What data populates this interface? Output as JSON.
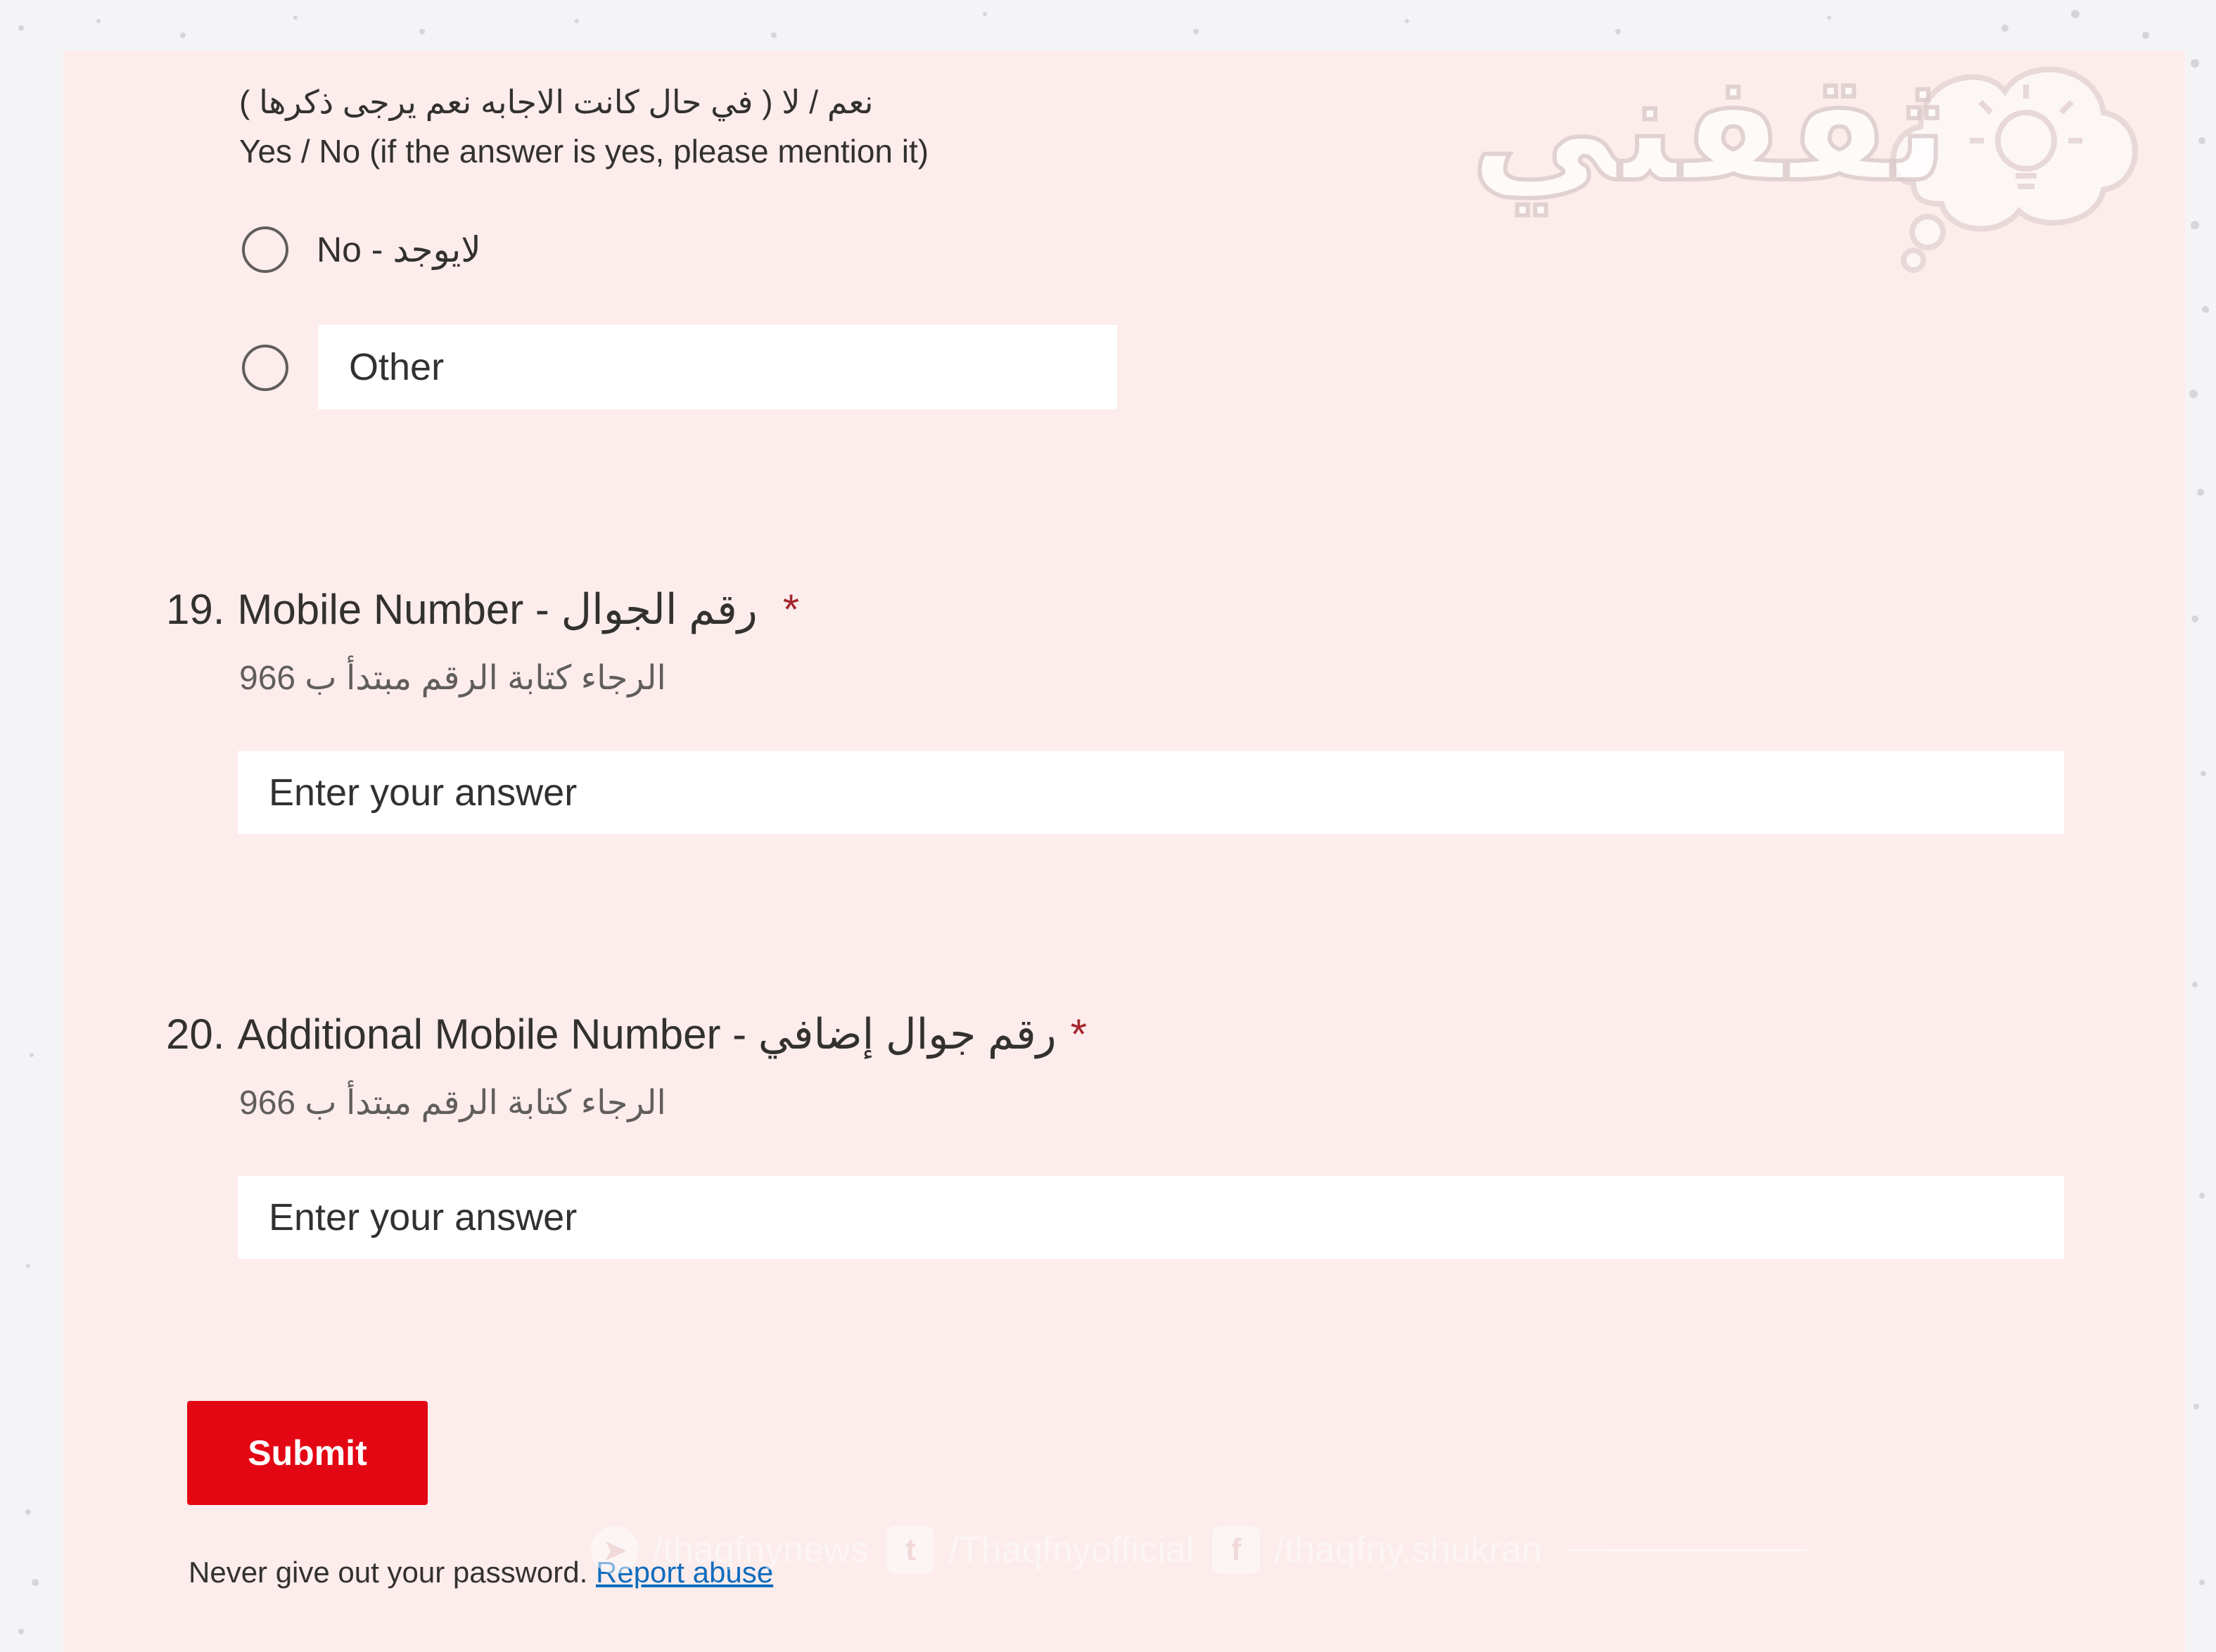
{
  "question18": {
    "description_ar": "نعم / لا ( في حال كانت الاجابه نعم يرجى ذكرها )",
    "description_en": "Yes / No (if the answer is yes, please mention it)",
    "options": [
      {
        "label": "No - لايوجد"
      },
      {
        "label": "Other"
      }
    ]
  },
  "question19": {
    "number": "19.",
    "title": "Mobile Number - رقم الجوال",
    "required_mark": "*",
    "subtitle": "الرجاء كتابة الرقم مبتدأ ب 966",
    "placeholder": "Enter your answer"
  },
  "question20": {
    "number": "20.",
    "title": "Additional Mobile Number  - رقم جوال إضافي",
    "required_mark": "*",
    "subtitle": "الرجاء كتابة الرقم مبتدأ ب 966",
    "placeholder": "Enter your answer"
  },
  "submit_label": "Submit",
  "footer": {
    "notice": "Never give out your password.",
    "report_link": "Report abuse"
  },
  "watermark": {
    "brand": "ثقفني",
    "social": [
      {
        "icon": "telegram-icon",
        "handle": "/thaqfnynews"
      },
      {
        "icon": "twitter-icon",
        "handle": "/Thaqfnyofficial"
      },
      {
        "icon": "facebook-icon",
        "handle": "/thaqfny.shukran"
      }
    ]
  },
  "colors": {
    "card_bg": "#fcecec",
    "page_bg": "#f4f3f5",
    "submit": "#e30613",
    "required": "#a4262c",
    "link": "#0f6cbd"
  }
}
